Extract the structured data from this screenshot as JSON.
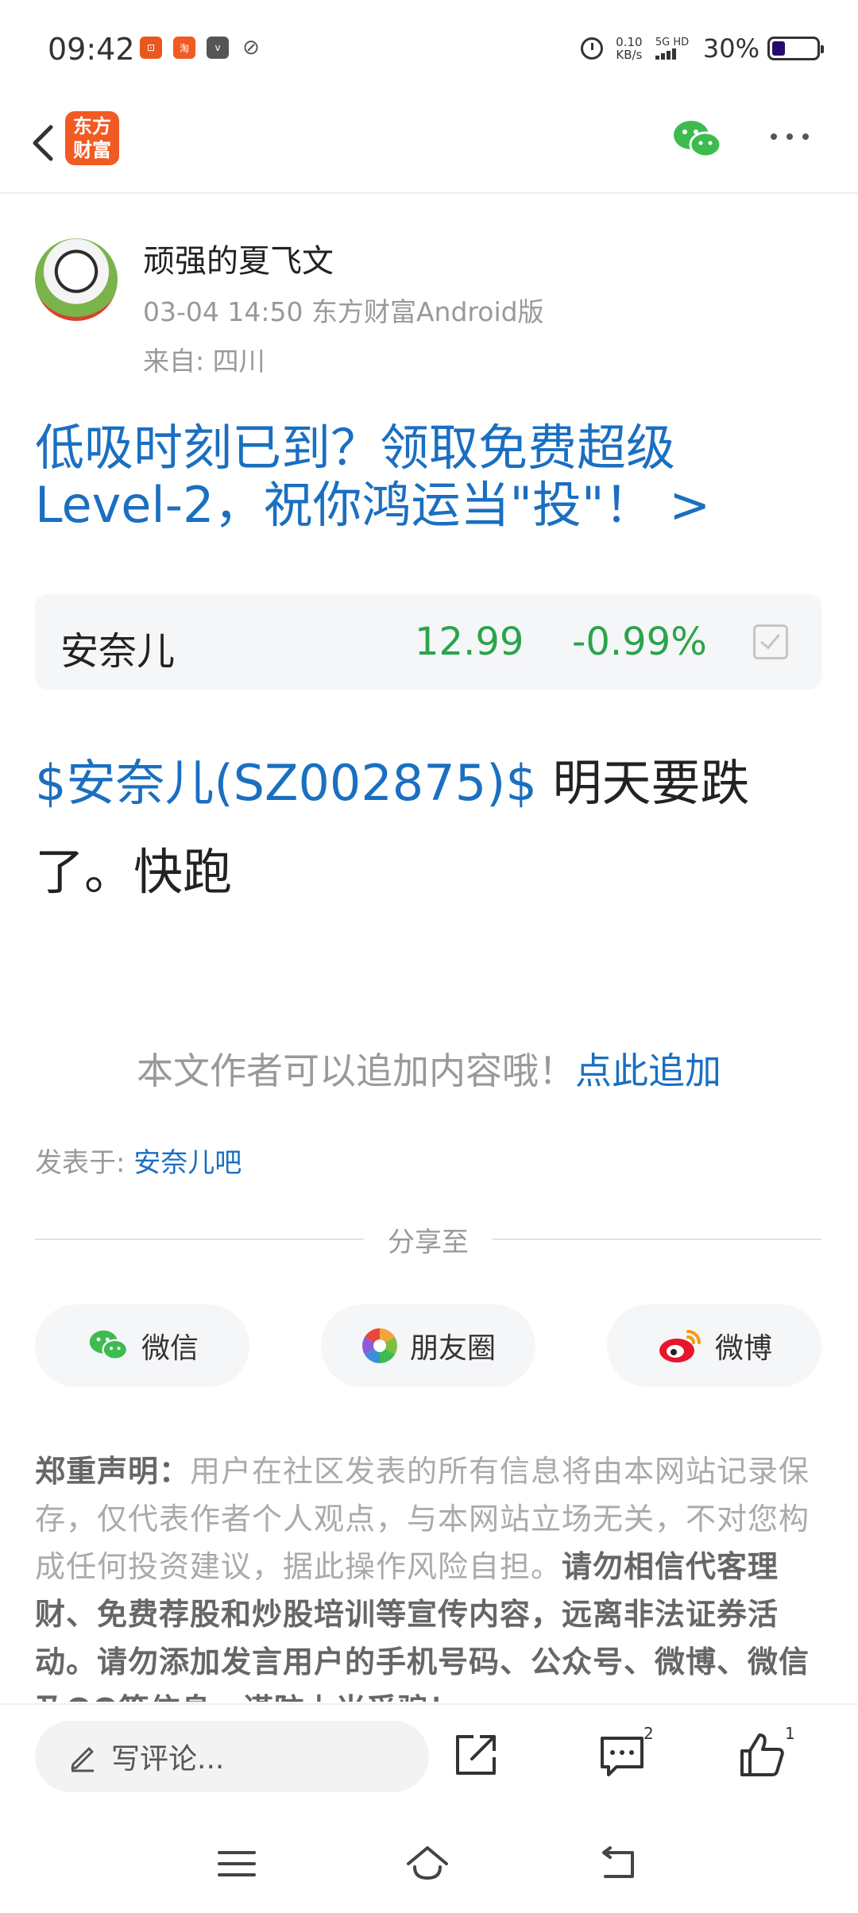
{
  "status_bar": {
    "time": "09:42",
    "net_speed_value": "0.10",
    "net_speed_unit": "KB/s",
    "network_type": "5G HD",
    "battery_percent": "30%",
    "battery_level": 0.3,
    "app_icons": [
      "pdd-app-icon",
      "taobao-app-icon",
      "vivo-app-icon",
      "sport-app-icon"
    ]
  },
  "nav": {
    "logo_line1": "东方",
    "logo_line2": "财富",
    "logo_color": "#f15a22"
  },
  "post": {
    "author": "顽强的夏飞文",
    "meta": "03-04 14:50 东方财富Android版",
    "from": "来自: 四川",
    "promo": "低吸时刻已到？领取免费超级Level-2，祝你鸿运当\"投\"！ >",
    "stock": {
      "name": "安奈儿",
      "price": "12.99",
      "change": "-0.99%"
    },
    "body_tag": "$安奈儿(SZ002875)$",
    "body_text": " 明天要跌了。快跑",
    "append_prompt": "本文作者可以追加内容哦！",
    "append_link": "点此追加",
    "published_in_label": "发表于: ",
    "published_in_bar": "安奈儿吧"
  },
  "share": {
    "label": "分享至",
    "wechat": "微信",
    "moments": "朋友圈",
    "weibo": "微博"
  },
  "disclaimer": {
    "title": "郑重声明：",
    "normal": "用户在社区发表的所有信息将由本网站记录保存，仅代表作者个人观点，与本网站立场无关，不对您构成任何投资建议，据此操作风险自担。",
    "bold": "请勿相信代客理财、免费荐股和炒股培训等宣传内容，远离非法证券活动。请勿添加发言用户的手机号码、公众号、微博、微信及QQ等信息，谨防上当受骗！"
  },
  "bottom_bar": {
    "comment_placeholder": "写评论...",
    "comment_count": "2",
    "like_count": "1"
  },
  "colors": {
    "link_blue": "#1a6fc1",
    "down_green": "#2aa44a",
    "wechat_green": "#3dbb4e"
  }
}
